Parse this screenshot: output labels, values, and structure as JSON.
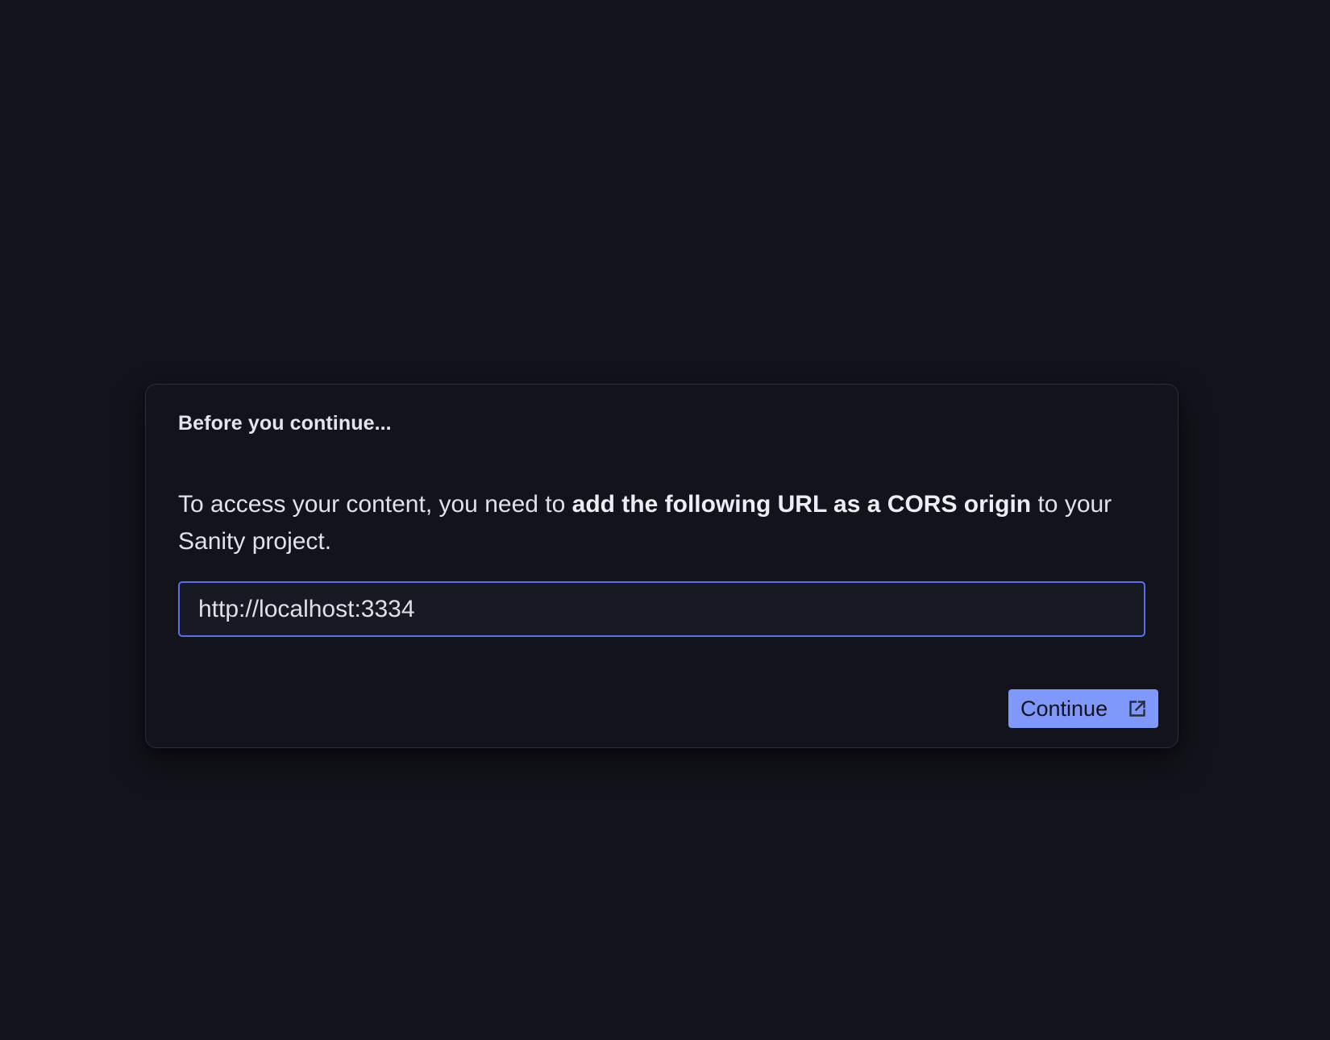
{
  "dialog": {
    "title": "Before you continue...",
    "body": {
      "before": "To access your content, you need to ",
      "emphasis": "add the following URL as a CORS origin",
      "after": " to your Sanity project."
    },
    "url_field": {
      "value": "http://localhost:3334"
    },
    "continue_button": {
      "label": "Continue",
      "icon": "external-link-icon"
    }
  },
  "colors": {
    "background": "#13141b",
    "dialog_border": "#2b2d38",
    "field_border": "#5b6ee8",
    "button_bg": "#7e98fb"
  }
}
